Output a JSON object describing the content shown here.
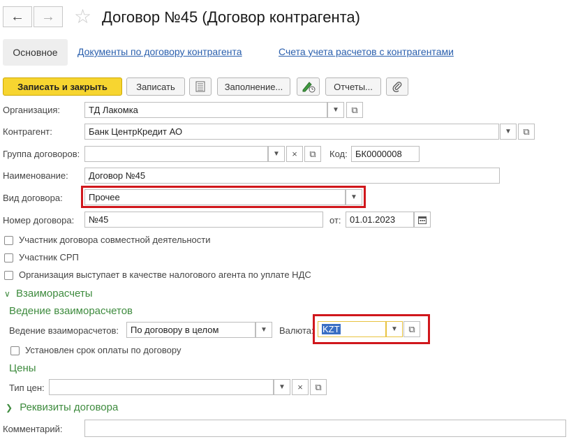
{
  "window": {
    "back_icon": "arrow-left-icon",
    "forward_icon": "arrow-right-icon",
    "favorite_icon": "star-icon",
    "title": "Договор №45 (Договор контрагента)"
  },
  "tabs": [
    {
      "label": "Основное",
      "active": true
    },
    {
      "label": "Документы по договору контрагента",
      "active": false
    },
    {
      "label": "Счета учета расчетов с контрагентами",
      "active": false
    }
  ],
  "toolbar": {
    "save_close": "Записать и закрыть",
    "save": "Записать",
    "fill": "Заполнение...",
    "reports": "Отчеты...",
    "accent": "#f7d530"
  },
  "form": {
    "org_label": "Организация:",
    "org_value": "ТД Лакомка",
    "contractor_label": "Контрагент:",
    "contractor_value": "Банк ЦентрКредит АО",
    "group_label": "Группа договоров:",
    "group_value": "",
    "code_label": "Код:",
    "code_value": "БК0000008",
    "name_label": "Наименование:",
    "name_value": "Договор №45",
    "type_label": "Вид договора:",
    "type_value": "Прочее",
    "number_label": "Номер договора:",
    "number_value": "№45",
    "date_label": "от:",
    "date_value": "01.01.2023",
    "check_joint": "Участник договора совместной деятельности",
    "check_srp": "Участник СРП",
    "check_tax_agent": "Организация выступает в качестве налогового агента по уплате НДС"
  },
  "settlements": {
    "section_title": "Взаиморасчеты",
    "subtitle": "Ведение взаиморасчетов",
    "mode_label": "Ведение взаиморасчетов:",
    "mode_value": "По договору в целом",
    "currency_label": "Валюта:",
    "currency_value": "KZT",
    "payment_term": "Установлен срок оплаты по договору"
  },
  "prices": {
    "subtitle": "Цены",
    "type_label": "Тип цен:",
    "type_value": ""
  },
  "details": {
    "section_title": "Реквизиты договора"
  },
  "comment": {
    "label": "Комментарий:",
    "value": ""
  },
  "colors": {
    "highlight": "#d0171c",
    "section_green": "#3e8b3e",
    "link_blue": "#2a5fad"
  }
}
